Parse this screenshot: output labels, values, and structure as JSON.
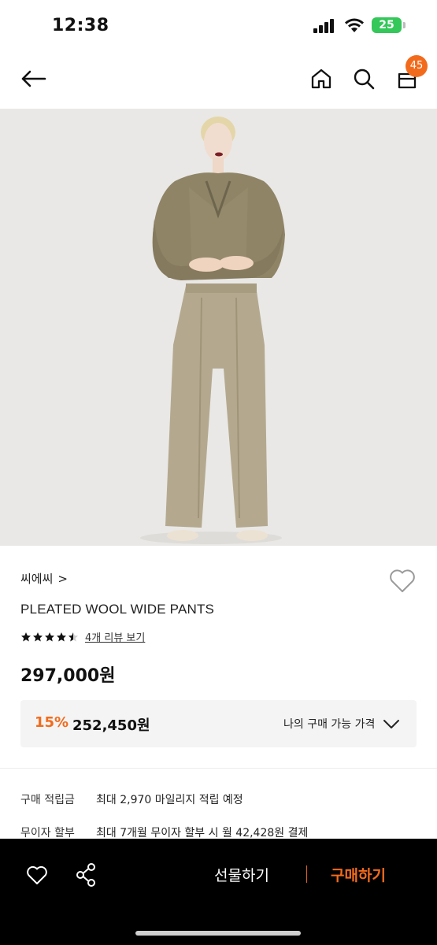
{
  "status_bar": {
    "time": "12:38",
    "battery": "25"
  },
  "nav": {
    "cart_count": "45"
  },
  "product": {
    "brand": "씨에씨",
    "brand_chevron": ">",
    "name": "PLEATED WOOL WIDE PANTS",
    "rating_stars": 4.5,
    "review_link": "4개 리뷰 보기",
    "price": "297,000원"
  },
  "discount": {
    "rate": "15%",
    "price": "252,450원",
    "my_price_label": "나의 구매 가능 가격"
  },
  "info_rows": [
    {
      "label": "구매 적립금",
      "value": "최대 2,970 마일리지 적립 예정"
    },
    {
      "label": "무이자 할부",
      "value": "최대 7개월 무이자 할부 시 월 42,428원 결제"
    }
  ],
  "bottom_bar": {
    "gift_label": "선물하기",
    "buy_label": "구매하기"
  },
  "colors": {
    "accent": "#f26b1d",
    "bar": "#000000",
    "discount_bg": "#f4f4f4"
  }
}
